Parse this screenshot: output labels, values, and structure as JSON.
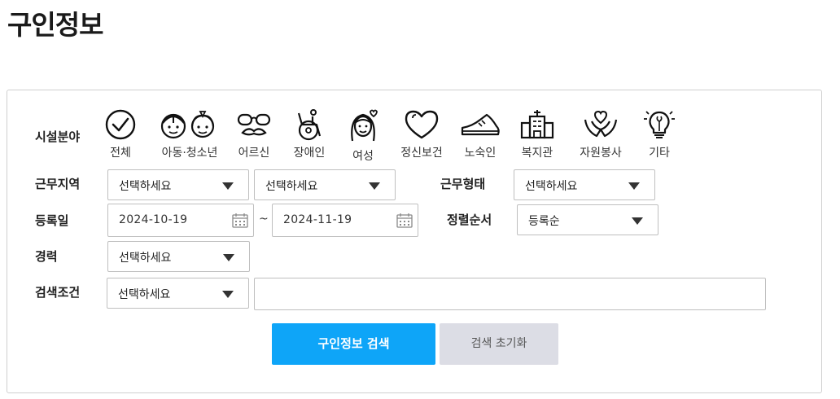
{
  "page": {
    "title": "구인정보"
  },
  "filters": {
    "facility_label": "시설분야",
    "categories": [
      {
        "label": "전체",
        "icon": "check-circle-icon"
      },
      {
        "label": "아동·청소년",
        "icon": "children-icon"
      },
      {
        "label": "어르신",
        "icon": "glasses-mustache-icon"
      },
      {
        "label": "장애인",
        "icon": "wheelchair-icon"
      },
      {
        "label": "여성",
        "icon": "woman-icon"
      },
      {
        "label": "정신보건",
        "icon": "heart-icon"
      },
      {
        "label": "노숙인",
        "icon": "shoe-icon"
      },
      {
        "label": "복지관",
        "icon": "building-icon"
      },
      {
        "label": "자원봉사",
        "icon": "hands-heart-icon"
      },
      {
        "label": "기타",
        "icon": "lightbulb-icon"
      }
    ],
    "region_label": "근무지역",
    "region_select_1": "선택하세요",
    "region_select_2": "선택하세요",
    "worktype_label": "근무형태",
    "worktype_select": "선택하세요",
    "regdate_label": "등록일",
    "date_from": "2024-10-19",
    "date_sep": "~",
    "date_to": "2024-11-19",
    "sort_label": "정렬순서",
    "sort_select": "등록순",
    "career_label": "경력",
    "career_select": "선택하세요",
    "condition_label": "검색조건",
    "condition_select": "선택하세요",
    "keyword_value": ""
  },
  "buttons": {
    "search": "구인정보 검색",
    "reset": "검색 초기화"
  }
}
